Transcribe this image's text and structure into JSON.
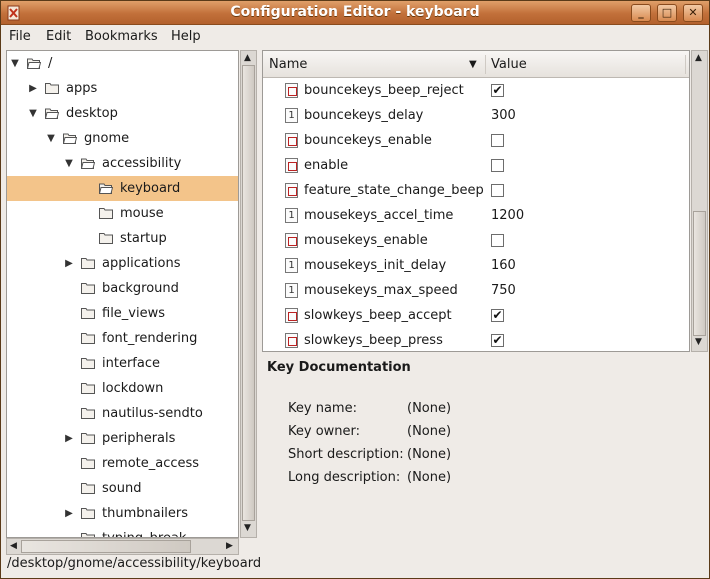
{
  "window": {
    "title": "Configuration Editor - keyboard"
  },
  "menubar": [
    {
      "label": "File",
      "accel": "F"
    },
    {
      "label": "Edit",
      "accel": "E"
    },
    {
      "label": "Bookmarks",
      "accel": "B"
    },
    {
      "label": "Help",
      "accel": "H"
    }
  ],
  "tree": [
    {
      "label": "/",
      "expander": "▼",
      "open": true
    },
    {
      "label": "apps",
      "expander": "▶",
      "open": false
    },
    {
      "label": "desktop",
      "expander": "▼",
      "open": true
    },
    {
      "label": "gnome",
      "expander": "▼",
      "open": true
    },
    {
      "label": "accessibility",
      "expander": "▼",
      "open": true
    },
    {
      "label": "keyboard",
      "expander": "",
      "open": true,
      "selected": true
    },
    {
      "label": "mouse",
      "expander": "",
      "open": false
    },
    {
      "label": "startup",
      "expander": "",
      "open": false
    },
    {
      "label": "applications",
      "expander": "▶",
      "open": false
    },
    {
      "label": "background",
      "expander": "",
      "open": false
    },
    {
      "label": "file_views",
      "expander": "",
      "open": false
    },
    {
      "label": "font_rendering",
      "expander": "",
      "open": false
    },
    {
      "label": "interface",
      "expander": "",
      "open": false
    },
    {
      "label": "lockdown",
      "expander": "",
      "open": false
    },
    {
      "label": "nautilus-sendto",
      "expander": "",
      "open": false
    },
    {
      "label": "peripherals",
      "expander": "▶",
      "open": false
    },
    {
      "label": "remote_access",
      "expander": "",
      "open": false
    },
    {
      "label": "sound",
      "expander": "",
      "open": false
    },
    {
      "label": "thumbnailers",
      "expander": "▶",
      "open": false
    },
    {
      "label": "typing_break",
      "expander": "",
      "open": false
    }
  ],
  "list": {
    "columns": {
      "name": "Name",
      "value": "Value",
      "sort_indicator": "▼"
    },
    "rows": [
      {
        "name": "bouncekeys_beep_reject",
        "type": "bool",
        "value": true
      },
      {
        "name": "bouncekeys_delay",
        "type": "int",
        "value": "300"
      },
      {
        "name": "bouncekeys_enable",
        "type": "bool",
        "value": false
      },
      {
        "name": "enable",
        "type": "bool",
        "value": false
      },
      {
        "name": "feature_state_change_beep",
        "type": "bool",
        "value": false
      },
      {
        "name": "mousekeys_accel_time",
        "type": "int",
        "value": "1200"
      },
      {
        "name": "mousekeys_enable",
        "type": "bool",
        "value": false
      },
      {
        "name": "mousekeys_init_delay",
        "type": "int",
        "value": "160"
      },
      {
        "name": "mousekeys_max_speed",
        "type": "int",
        "value": "750"
      },
      {
        "name": "slowkeys_beep_accept",
        "type": "bool",
        "value": true
      },
      {
        "name": "slowkeys_beep_press",
        "type": "bool",
        "value": true
      }
    ]
  },
  "docs": {
    "heading": "Key Documentation",
    "key_name_label": "Key name:",
    "key_name": "(None)",
    "key_owner_label": "Key owner:",
    "key_owner": "(None)",
    "short_desc_label": "Short description:",
    "short_desc": "(None)",
    "long_desc_label": "Long description:",
    "long_desc": "(None)"
  },
  "status": {
    "path": "/desktop/gnome/accessibility/keyboard"
  },
  "icons": {
    "int_glyph": "1",
    "check_glyph": "✔"
  },
  "colors": {
    "selection": "#f3c48a",
    "titlebar": "#c2703a"
  }
}
